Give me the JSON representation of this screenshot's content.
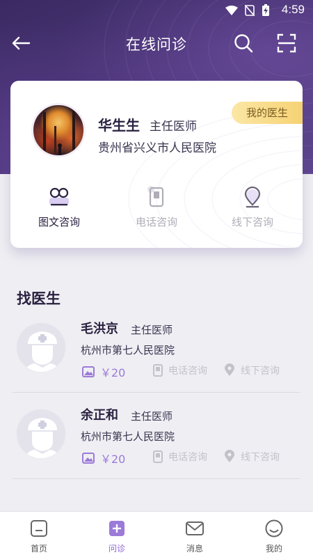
{
  "status_bar": {
    "time": "4:59"
  },
  "nav": {
    "title": "在线问诊"
  },
  "my_doctor": {
    "name": "华生生",
    "title": "主任医师",
    "hospital": "贵州省兴义市人民医院",
    "badge": "我的医生",
    "consult_options": [
      {
        "label": "图文咨询",
        "icon": "chat-icon",
        "active": true
      },
      {
        "label": "电话咨询",
        "icon": "phone-icon",
        "active": false
      },
      {
        "label": "线下咨询",
        "icon": "location-pin-icon",
        "active": false
      }
    ]
  },
  "find_doctor": {
    "title": "找医生",
    "doctors": [
      {
        "name": "毛洪京",
        "title": "主任医师",
        "hospital": "杭州市第七人民医院",
        "price": "￥20",
        "phone_label": "电话咨询",
        "offline_label": "线下咨询"
      },
      {
        "name": "余正和",
        "title": "主任医师",
        "hospital": "杭州市第七人民医院",
        "price": "￥20",
        "phone_label": "电话咨询",
        "offline_label": "线下咨询"
      }
    ]
  },
  "tabs": [
    {
      "label": "首页",
      "icon": "home-icon"
    },
    {
      "label": "问诊",
      "icon": "consult-plus-icon",
      "active": true
    },
    {
      "label": "消息",
      "icon": "mail-icon"
    },
    {
      "label": "我的",
      "icon": "profile-smile-icon"
    }
  ],
  "colors": {
    "accent": "#8a63d2",
    "header": "#4b3576",
    "badge": "#f6d274"
  }
}
